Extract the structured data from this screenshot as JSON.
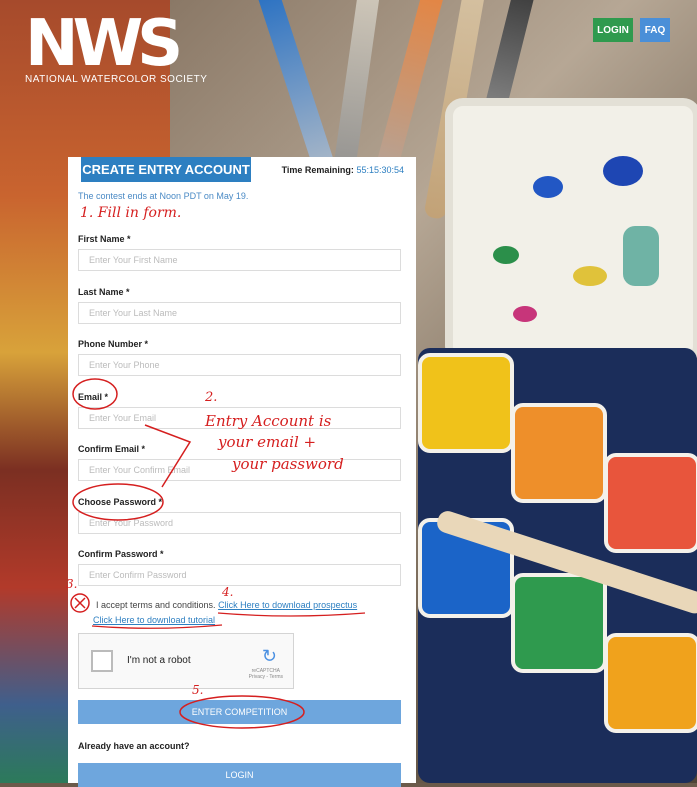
{
  "header": {
    "logo": "NWS",
    "logo_sub": "NATIONAL WATERCOLOR SOCIETY",
    "login_label": "LOGIN",
    "faq_label": "FAQ"
  },
  "form": {
    "title": "CREATE ENTRY ACCOUNT",
    "time_label": "Time Remaining:",
    "time_value": "55:15:30:54",
    "contest_ends": "The contest ends at Noon PDT on May 19.",
    "fields": [
      {
        "label": "First Name *",
        "placeholder": "Enter Your First Name"
      },
      {
        "label": "Last Name *",
        "placeholder": "Enter Your Last Name"
      },
      {
        "label": "Phone Number *",
        "placeholder": "Enter Your Phone"
      },
      {
        "label": "Email *",
        "placeholder": "Enter Your Email"
      },
      {
        "label": "Confirm Email *",
        "placeholder": "Enter Your Confirm Email"
      },
      {
        "label": "Choose Password *",
        "placeholder": "Enter Your Password"
      },
      {
        "label": "Confirm Password *",
        "placeholder": "Enter Confirm Password"
      }
    ],
    "terms_text": "I accept terms and conditions.",
    "prospectus_link": "Click Here to download prospectus",
    "tutorial_link": "Click Here to download tutorial",
    "recaptcha_label": "I'm not a robot",
    "recaptcha_brand": "reCAPTCHA",
    "recaptcha_sub": "Privacy - Terms",
    "enter_button": "ENTER COMPETITION",
    "already_text": "Already have an account?",
    "login_button": "LOGIN"
  },
  "annotations": {
    "n1": "1. Fill in form.",
    "n2": "2.",
    "note_line1": "Entry Account is",
    "note_line2": "your email +",
    "note_line3": "your password",
    "n3": "3.",
    "n4": "4.",
    "n5": "5."
  },
  "colors": {
    "accent": "#2d7fc1",
    "button": "#6ea6dd",
    "annotation": "#d51f1f"
  }
}
